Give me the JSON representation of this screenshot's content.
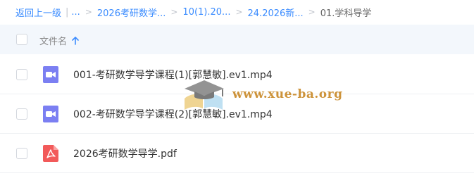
{
  "breadcrumb": {
    "back_label": "返回上一级",
    "ellipsis": "...",
    "items": [
      "2026考研数学...",
      "10(1).20...",
      "24.2026新..."
    ],
    "current": "01.学科导学"
  },
  "header": {
    "name_column_label": "文件名",
    "sort_icon": "arrow-up-icon"
  },
  "files": [
    {
      "name": "001-考研数学导学课程(1)[郭慧敏].ev1.mp4",
      "type": "video",
      "icon": "video-file-icon",
      "icon_color": "#7b7ff2"
    },
    {
      "name": "002-考研数学导学课程(2)[郭慧敏].ev1.mp4",
      "type": "video",
      "icon": "video-file-icon",
      "icon_color": "#7b7ff2"
    },
    {
      "name": "2026考研数学导学.pdf",
      "type": "pdf",
      "icon": "pdf-file-icon",
      "icon_color": "#f25a5a"
    }
  ],
  "watermark": {
    "text": "www.xue-ba.org"
  },
  "colors": {
    "link": "#3b8cff",
    "header_bg": "#f3f7fc",
    "watermark": "#c98a2a"
  }
}
